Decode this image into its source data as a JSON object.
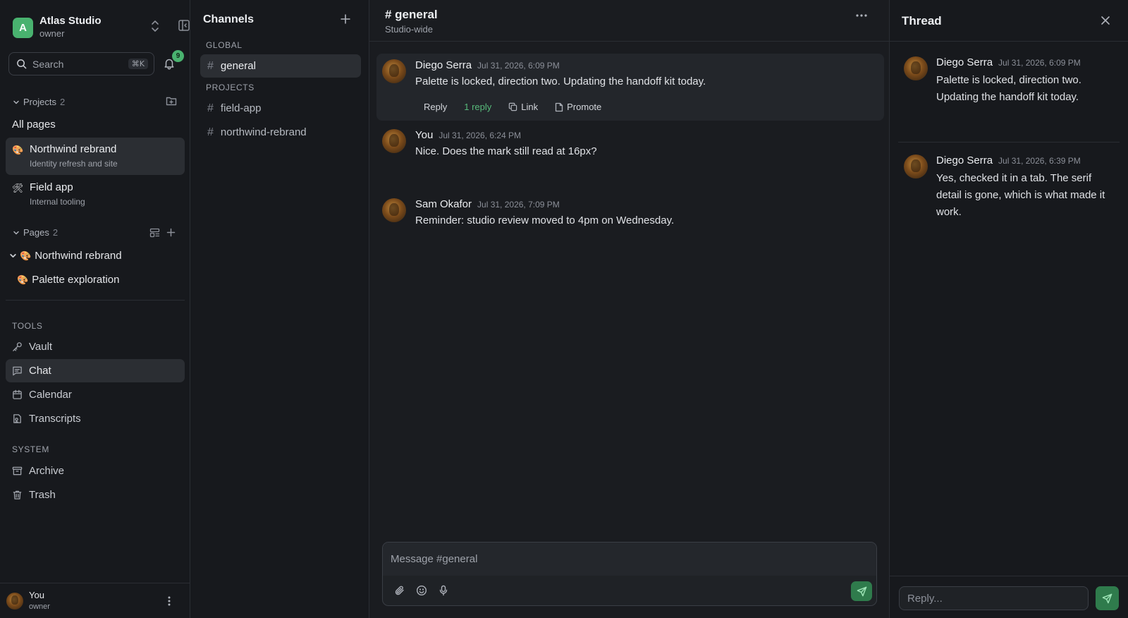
{
  "workspace": {
    "initial": "A",
    "name": "Atlas Studio",
    "role": "owner",
    "accent": "#49b26f"
  },
  "search": {
    "label": "Search",
    "shortcut": "⌘K"
  },
  "notifications": {
    "count": "9"
  },
  "projects": {
    "label": "Projects",
    "count": "2",
    "all_pages": "All pages",
    "items": [
      {
        "icon": "palette-icon",
        "emoji": "🎨",
        "title": "Northwind rebrand",
        "subtitle": "Identity refresh and site",
        "active": true
      },
      {
        "icon": "tools-icon",
        "emoji": "🛠",
        "title": "Field app",
        "subtitle": "Internal tooling",
        "active": false
      }
    ]
  },
  "pages": {
    "label": "Pages",
    "count": "2",
    "items": [
      {
        "emoji": "🎨",
        "label": "Northwind rebrand"
      },
      {
        "emoji": "🎨",
        "label": "Palette exploration"
      }
    ]
  },
  "tools": {
    "label": "TOOLS",
    "items": [
      {
        "icon": "key-icon",
        "label": "Vault"
      },
      {
        "icon": "chat-icon",
        "label": "Chat",
        "active": true
      },
      {
        "icon": "calendar-icon",
        "label": "Calendar"
      },
      {
        "icon": "transcript-icon",
        "label": "Transcripts"
      }
    ]
  },
  "system": {
    "label": "SYSTEM",
    "items": [
      {
        "icon": "archive-icon",
        "label": "Archive"
      },
      {
        "icon": "trash-icon",
        "label": "Trash"
      }
    ]
  },
  "current_user": {
    "name": "You",
    "role": "owner"
  },
  "channels": {
    "title": "Channels",
    "global_label": "GLOBAL",
    "projects_label": "PROJECTS",
    "global": [
      {
        "name": "general",
        "active": true
      }
    ],
    "project": [
      {
        "name": "field-app"
      },
      {
        "name": "northwind-rebrand"
      }
    ]
  },
  "channel": {
    "title": "# general",
    "subtitle": "Studio-wide"
  },
  "messages": [
    {
      "author": "Diego Serra",
      "time": "Jul 31, 2026, 6:09 PM",
      "body": "Palette is locked, direction two. Updating the handoff kit today."
    },
    {
      "author": "You",
      "time": "Jul 31, 2026, 6:24 PM",
      "body": "Nice. Does the mark still read at 16px?"
    },
    {
      "author": "Sam Okafor",
      "time": "Jul 31, 2026, 7:09 PM",
      "body": "Reminder: studio review moved to 4pm on Wednesday."
    }
  ],
  "message_actions": {
    "reply": "Reply",
    "replies": "1 reply",
    "link": "Link",
    "promote": "Promote"
  },
  "composer": {
    "placeholder": "Message #general"
  },
  "thread": {
    "title": "Thread",
    "messages": [
      {
        "author": "Diego Serra",
        "time": "Jul 31, 2026, 6:09 PM",
        "body": "Palette is locked, direction two. Updating the handoff kit today."
      },
      {
        "author": "Diego Serra",
        "time": "Jul 31, 2026, 6:39 PM",
        "body": "Yes, checked it in a tab. The serif detail is gone, which is what made it work."
      }
    ],
    "reply_placeholder": "Reply..."
  }
}
